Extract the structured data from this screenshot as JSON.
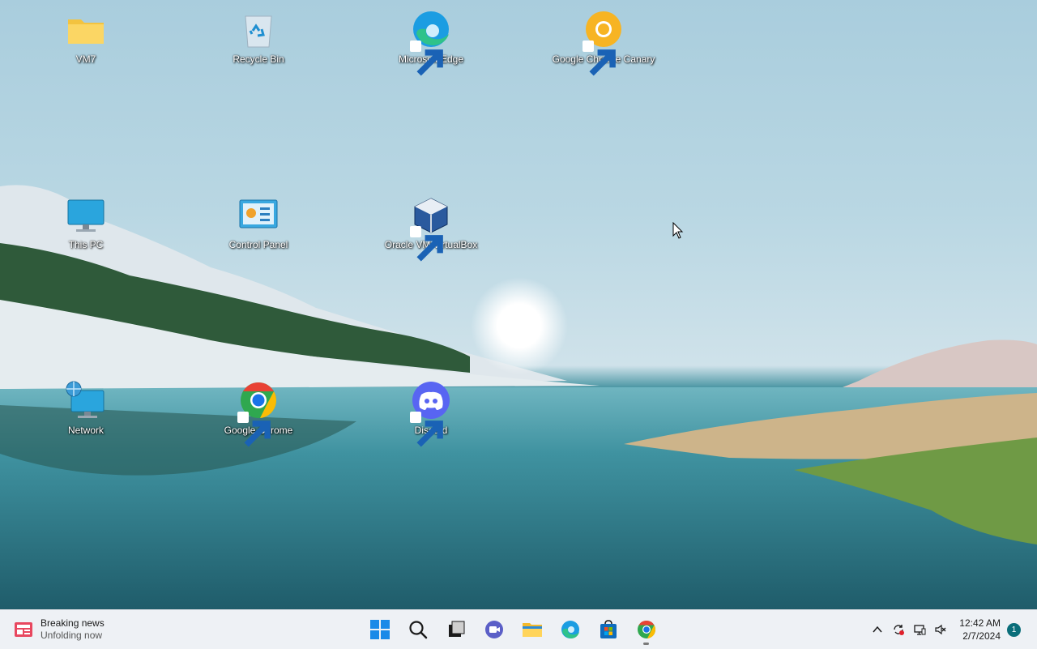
{
  "desktop": {
    "icons": [
      {
        "label": "VM7",
        "icon": "folder-icon"
      },
      {
        "label": "Recycle Bin",
        "icon": "recycle-bin-icon"
      },
      {
        "label": "Microsoft Edge",
        "icon": "edge-icon"
      },
      {
        "label": "Google Chrome Canary",
        "icon": "chrome-canary-icon"
      },
      {
        "label": "This PC",
        "icon": "monitor-icon"
      },
      {
        "label": "Control Panel",
        "icon": "control-panel-icon"
      },
      {
        "label": "Oracle VM VirtualBox",
        "icon": "virtualbox-icon"
      },
      {
        "label": "Network",
        "icon": "network-icon"
      },
      {
        "label": "Google Chrome",
        "icon": "chrome-icon"
      },
      {
        "label": "Discord",
        "icon": "discord-icon"
      }
    ]
  },
  "taskbar": {
    "news": {
      "title": "Breaking news",
      "subtitle": "Unfolding now"
    },
    "apps": [
      "start-icon",
      "search-icon",
      "task-view-icon",
      "teams-chat-icon",
      "file-explorer-icon",
      "edge-icon",
      "store-icon",
      "chrome-icon"
    ],
    "clock": {
      "time": "12:42 AM",
      "date": "2/7/2024"
    },
    "notification_count": "1"
  },
  "colors": {
    "accent": "#0a6e7a",
    "taskbar": "#eef1f5"
  }
}
